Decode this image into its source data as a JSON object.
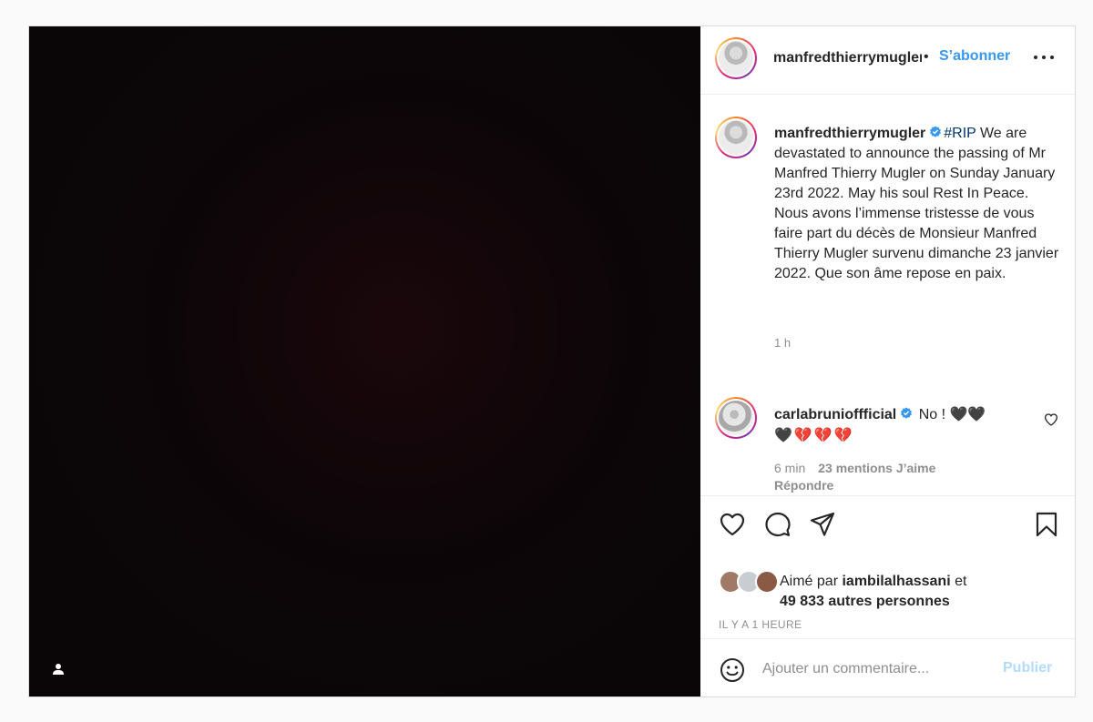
{
  "post": {
    "author": "manfredthierrymugler",
    "header_dot": "•",
    "follow_label": "S’abonner",
    "caption": {
      "username": "manfredthierrymugler",
      "hashtag": "#RIP",
      "text_en": " We are devastated to announce the passing of Mr Manfred Thierry Mugler on Sunday January 23rd 2022. May his soul Rest In Peace.",
      "text_fr": "Nous avons l’immense tristesse de vous faire part du décès de Monsieur Manfred Thierry Mugler survenu dimanche 23 janvier 2022. Que son âme repose en paix.",
      "time": "1 h"
    },
    "top_comment": {
      "username": "carlabrunioffficial",
      "text": "No ! 🖤🖤",
      "emojis": "🖤💔💔💔",
      "time": "6 min",
      "likes": "23 mentions J’aime",
      "reply_label": "Répondre"
    },
    "liked_by": {
      "prefix": "Aimé par ",
      "user": "iambilalhassani",
      "connector": " et",
      "others": "49 833 autres personnes"
    },
    "time_ago": "IL Y A 1 HEURE",
    "comment_placeholder": "Ajouter un commentaire...",
    "publish_label": "Publier"
  },
  "icons": {
    "tag": "user-tag-icon",
    "more": "more-options-icon",
    "verified": "verified-badge-icon",
    "heart": "heart-icon",
    "comment": "comment-icon",
    "share": "share-icon",
    "save": "bookmark-icon",
    "emoji": "emoji-icon"
  },
  "colors": {
    "link_blue": "#3897f0",
    "publish_disabled": "#b3dbff",
    "hashtag": "#00376b",
    "muted": "#8e8e8e",
    "media_bg": "#0a0608"
  }
}
